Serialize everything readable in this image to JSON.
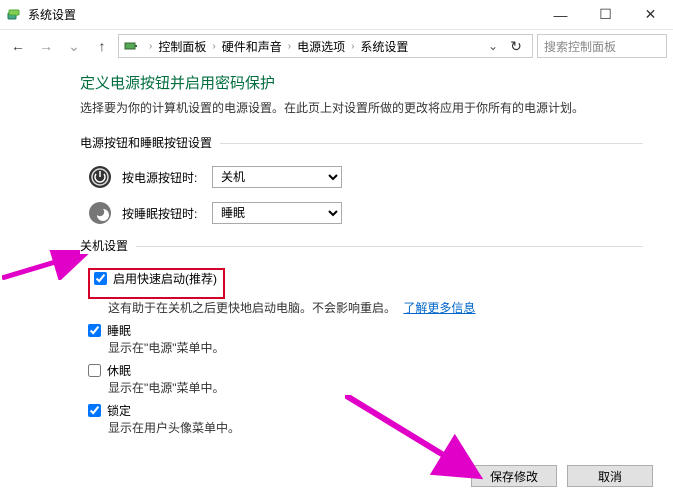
{
  "window": {
    "title": "系统设置"
  },
  "winbtns": {
    "min": "—",
    "max": "☐",
    "close": "✕"
  },
  "nav": {
    "back": "←",
    "forward": "→",
    "up": "↑",
    "refresh": "↻"
  },
  "breadcrumb": {
    "items": [
      "控制面板",
      "硬件和声音",
      "电源选项",
      "系统设置"
    ],
    "sep": "›",
    "dropdown": "⌄"
  },
  "search": {
    "placeholder": "搜索控制面板"
  },
  "page": {
    "title": "定义电源按钮并启用密码保护",
    "desc": "选择要为你的计算机设置的电源设置。在此页上对设置所做的更改将应用于你所有的电源计划。"
  },
  "section1": {
    "header": "电源按钮和睡眠按钮设置",
    "rows": [
      {
        "label": "按电源按钮时:",
        "value": "关机"
      },
      {
        "label": "按睡眠按钮时:",
        "value": "睡眠"
      }
    ]
  },
  "section2": {
    "header": "关机设置",
    "opts": [
      {
        "label": "启用快速启动(推荐)",
        "checked": true,
        "desc_a": "这有助于在关机之后更快地启动电脑。不会影响重启。",
        "link": "了解更多信息"
      },
      {
        "label": "睡眠",
        "checked": true,
        "desc": "显示在\"电源\"菜单中。"
      },
      {
        "label": "休眠",
        "checked": false,
        "desc": "显示在\"电源\"菜单中。"
      },
      {
        "label": "锁定",
        "checked": true,
        "desc": "显示在用户头像菜单中。"
      }
    ]
  },
  "footer": {
    "save": "保存修改",
    "cancel": "取消"
  }
}
